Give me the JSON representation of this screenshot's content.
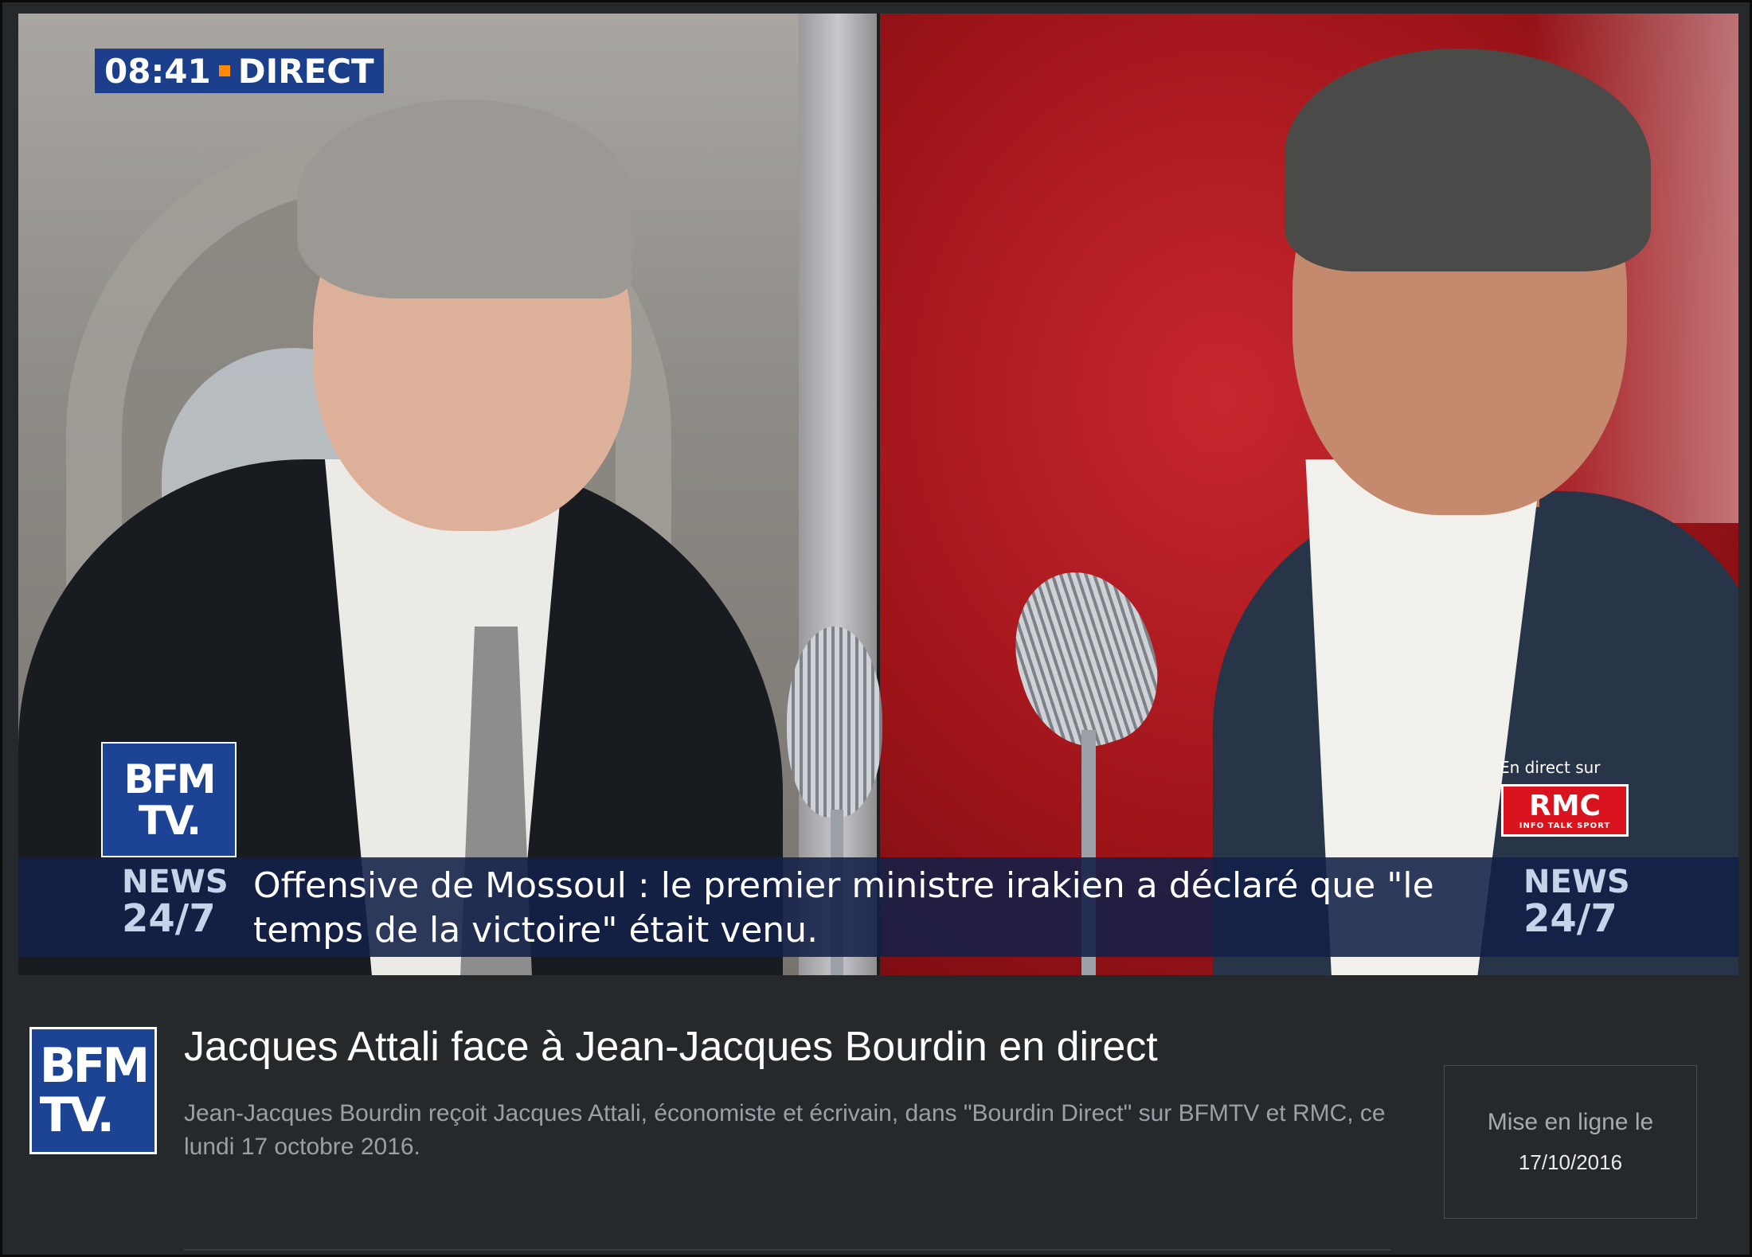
{
  "video": {
    "time": "08:41",
    "live_label": "DIRECT",
    "channel_logo_text": "BFM\nTV.",
    "news_label_top": "NEWS",
    "news_label_bottom": "24/7",
    "partner_caption": "En direct sur",
    "partner_logo": "RMC",
    "partner_tagline": "INFO TALK SPORT",
    "ticker": "Offensive de Mossoul : le premier ministre irakien a déclaré que \"le temps de la victoire\" était venu.",
    "colors": {
      "brand_blue": "#1d4494",
      "ticker_bg": "#122048",
      "rmc_red": "#d9141f",
      "live_dot": "#ff8a00"
    }
  },
  "info": {
    "logo_text": "BFM\nTV.",
    "title": "Jacques Attali face à Jean-Jacques Bourdin en direct",
    "description": "Jean-Jacques Bourdin reçoit Jacques Attali, économiste et écrivain, dans \"Bourdin Direct\" sur BFMTV et RMC, ce lundi 17 octobre 2016.",
    "published_label": "Mise en ligne le",
    "published_date": "17/10/2016"
  }
}
